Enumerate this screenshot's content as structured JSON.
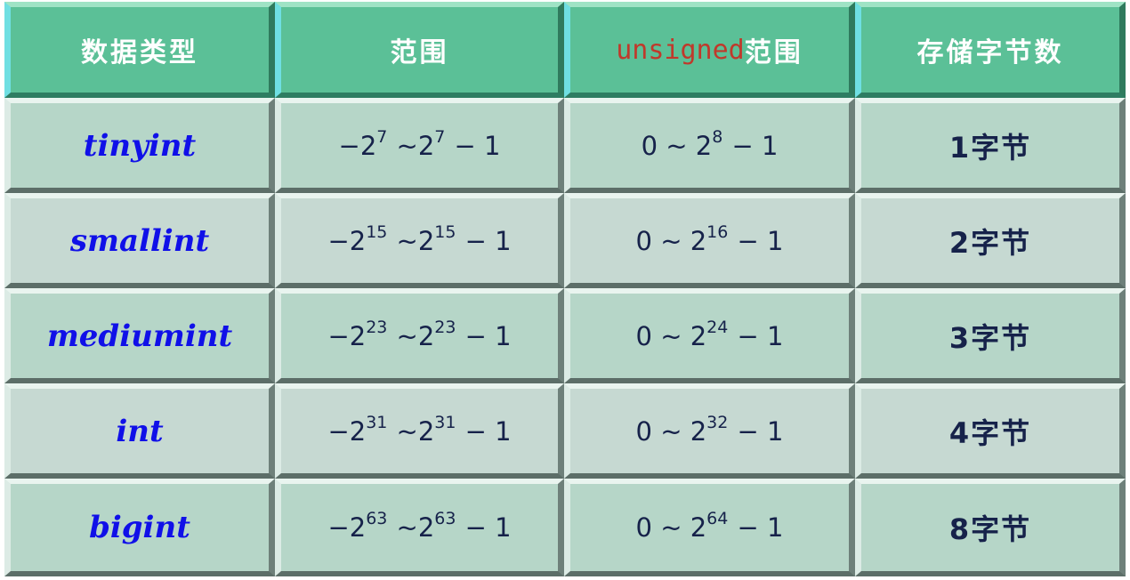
{
  "headers": {
    "type": "数据类型",
    "range": "范围",
    "unsigned_prefix": "unsigned",
    "unsigned_suffix": "范围",
    "bytes": "存储字节数"
  },
  "rows": [
    {
      "name": "tinyint",
      "signed_exp": "7",
      "unsigned_exp": "8",
      "bytes": "1字节"
    },
    {
      "name": "smallint",
      "signed_exp": "15",
      "unsigned_exp": "16",
      "bytes": "2字节"
    },
    {
      "name": "mediumint",
      "signed_exp": "23",
      "unsigned_exp": "24",
      "bytes": "3字节"
    },
    {
      "name": "int",
      "signed_exp": "31",
      "unsigned_exp": "32",
      "bytes": "4字节"
    },
    {
      "name": "bigint",
      "signed_exp": "63",
      "unsigned_exp": "64",
      "bytes": "8字节"
    }
  ],
  "math": {
    "minus": "−2",
    "tilde_two": "~2",
    "minus_one": "− 1",
    "zero_tilde_two": "0 ~ 2"
  },
  "colors": {
    "header_bg": "#5bc097",
    "row_bg_a": "#b6d6c8",
    "row_bg_b": "#c6d9d2",
    "type_text": "#1010e8",
    "unsigned_text": "#c0392b",
    "math_text": "#16224a"
  }
}
